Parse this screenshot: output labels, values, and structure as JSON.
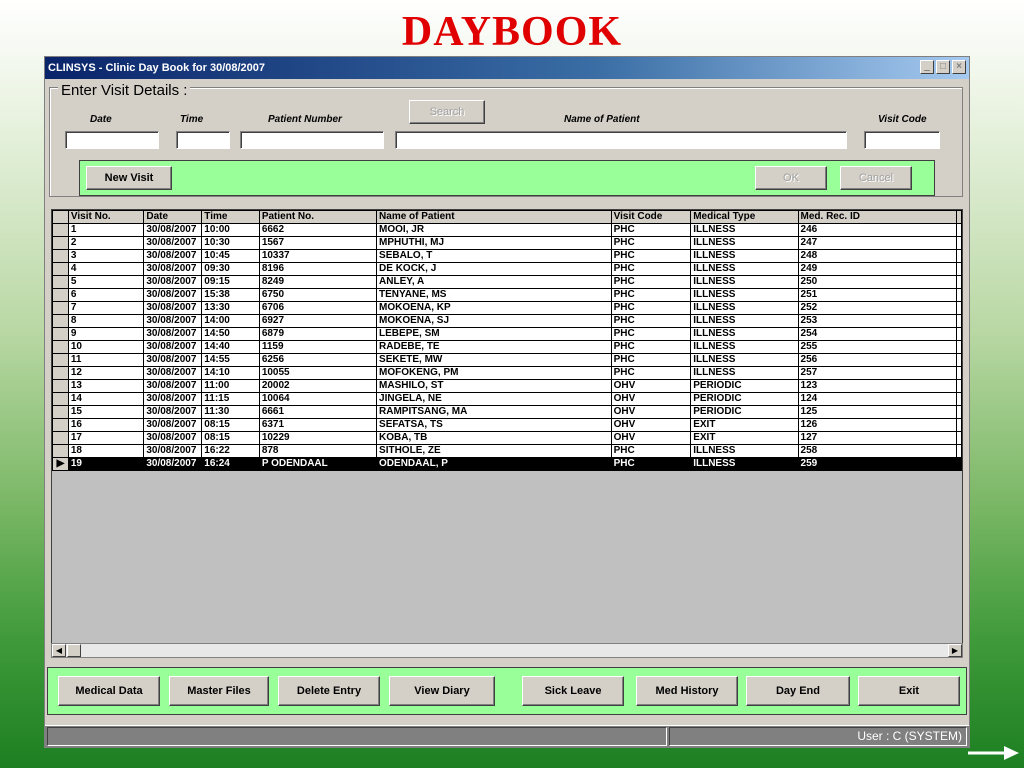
{
  "slide": {
    "title": "DAYBOOK"
  },
  "window": {
    "title": "CLINSYS - Clinic Day Book for 30/08/2007",
    "min": "_",
    "max": "□",
    "close": "×"
  },
  "visit_details": {
    "legend": "Enter Visit Details :",
    "labels": {
      "date": "Date",
      "time": "Time",
      "patient_number": "Patient Number",
      "name": "Name of Patient",
      "visit_code": "Visit Code"
    },
    "search_button": "Search",
    "new_visit_button": "New Visit",
    "ok_button": "OK",
    "cancel_button": "Cancel"
  },
  "grid": {
    "columns": [
      "Visit No.",
      "Date",
      "Time",
      "Patient No.",
      "Name of Patient",
      "Visit Code",
      "Medical Type",
      "Med. Rec. ID"
    ],
    "rows": [
      [
        "1",
        "30/08/2007",
        "10:00",
        "6662",
        "MOOI, JR",
        "PHC",
        "ILLNESS",
        "246"
      ],
      [
        "2",
        "30/08/2007",
        "10:30",
        "1567",
        "MPHUTHI, MJ",
        "PHC",
        "ILLNESS",
        "247"
      ],
      [
        "3",
        "30/08/2007",
        "10:45",
        "10337",
        "SEBALO, T",
        "PHC",
        "ILLNESS",
        "248"
      ],
      [
        "4",
        "30/08/2007",
        "09:30",
        "8196",
        "DE KOCK, J",
        "PHC",
        "ILLNESS",
        "249"
      ],
      [
        "5",
        "30/08/2007",
        "09:15",
        "8249",
        "ANLEY, A",
        "PHC",
        "ILLNESS",
        "250"
      ],
      [
        "6",
        "30/08/2007",
        "15:38",
        "6750",
        "TENYANE, MS",
        "PHC",
        "ILLNESS",
        "251"
      ],
      [
        "7",
        "30/08/2007",
        "13:30",
        "6706",
        "MOKOENA, KP",
        "PHC",
        "ILLNESS",
        "252"
      ],
      [
        "8",
        "30/08/2007",
        "14:00",
        "6927",
        "MOKOENA, SJ",
        "PHC",
        "ILLNESS",
        "253"
      ],
      [
        "9",
        "30/08/2007",
        "14:50",
        "6879",
        "LEBEPE, SM",
        "PHC",
        "ILLNESS",
        "254"
      ],
      [
        "10",
        "30/08/2007",
        "14:40",
        "1159",
        "RADEBE, TE",
        "PHC",
        "ILLNESS",
        "255"
      ],
      [
        "11",
        "30/08/2007",
        "14:55",
        "6256",
        "SEKETE, MW",
        "PHC",
        "ILLNESS",
        "256"
      ],
      [
        "12",
        "30/08/2007",
        "14:10",
        "10055",
        "MOFOKENG, PM",
        "PHC",
        "ILLNESS",
        "257"
      ],
      [
        "13",
        "30/08/2007",
        "11:00",
        "20002",
        "MASHILO, ST",
        "OHV",
        "PERIODIC",
        "123"
      ],
      [
        "14",
        "30/08/2007",
        "11:15",
        "10064",
        "JINGELA, NE",
        "OHV",
        "PERIODIC",
        "124"
      ],
      [
        "15",
        "30/08/2007",
        "11:30",
        "6661",
        "RAMPITSANG, MA",
        "OHV",
        "PERIODIC",
        "125"
      ],
      [
        "16",
        "30/08/2007",
        "08:15",
        "6371",
        "SEFATSA, TS",
        "OHV",
        "EXIT",
        "126"
      ],
      [
        "17",
        "30/08/2007",
        "08:15",
        "10229",
        "KOBA, TB",
        "OHV",
        "EXIT",
        "127"
      ],
      [
        "18",
        "30/08/2007",
        "16:22",
        "878",
        "SITHOLE, ZE",
        "PHC",
        "ILLNESS",
        "258"
      ],
      [
        "19",
        "30/08/2007",
        "16:24",
        "P ODENDAAL",
        "ODENDAAL, P",
        "PHC",
        "ILLNESS",
        "259"
      ]
    ],
    "selected_row": 18,
    "row_indicator": "▶"
  },
  "toolbar": {
    "buttons": [
      "Medical Data",
      "Master Files",
      "Delete Entry",
      "View Diary",
      "Sick Leave",
      "Med History",
      "Day End",
      "Exit"
    ]
  },
  "status": {
    "user": "User : C  (SYSTEM)"
  },
  "colors": {
    "green_panel": "#99ff99",
    "title_red": "#e00000"
  }
}
